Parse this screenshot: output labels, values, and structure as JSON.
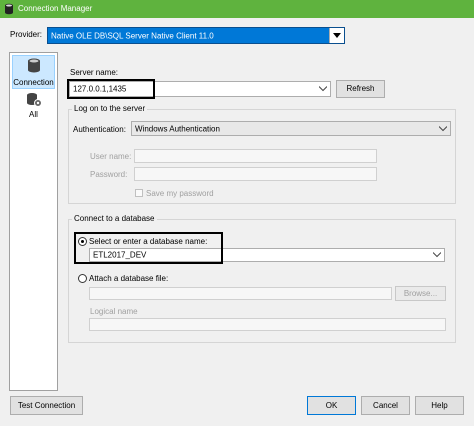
{
  "window": {
    "title": "Connection Manager"
  },
  "provider": {
    "label": "Provider:",
    "value": "Native OLE DB\\SQL Server Native Client 11.0"
  },
  "sidebar": {
    "items": [
      {
        "label": "Connection"
      },
      {
        "label": "All"
      }
    ]
  },
  "server": {
    "label": "Server name:",
    "value": "127.0.0.1,1435",
    "refresh_label": "Refresh"
  },
  "logon": {
    "title": "Log on to the server",
    "auth_label": "Authentication:",
    "auth_value": "Windows Authentication",
    "username_label": "User name:",
    "password_label": "Password:",
    "save_password_label": "Save my password"
  },
  "database": {
    "title": "Connect to a database",
    "select_radio_label": "Select or enter a database name:",
    "database_value": "ETL2017_DEV",
    "attach_radio_label": "Attach a database file:",
    "browse_label": "Browse...",
    "logical_name_label": "Logical name"
  },
  "footer": {
    "test_label": "Test Connection",
    "ok_label": "OK",
    "cancel_label": "Cancel",
    "help_label": "Help"
  },
  "colors": {
    "titlebar": "#5fb33e",
    "selection": "#0078d7",
    "nav_selected": "#cce8ff"
  }
}
